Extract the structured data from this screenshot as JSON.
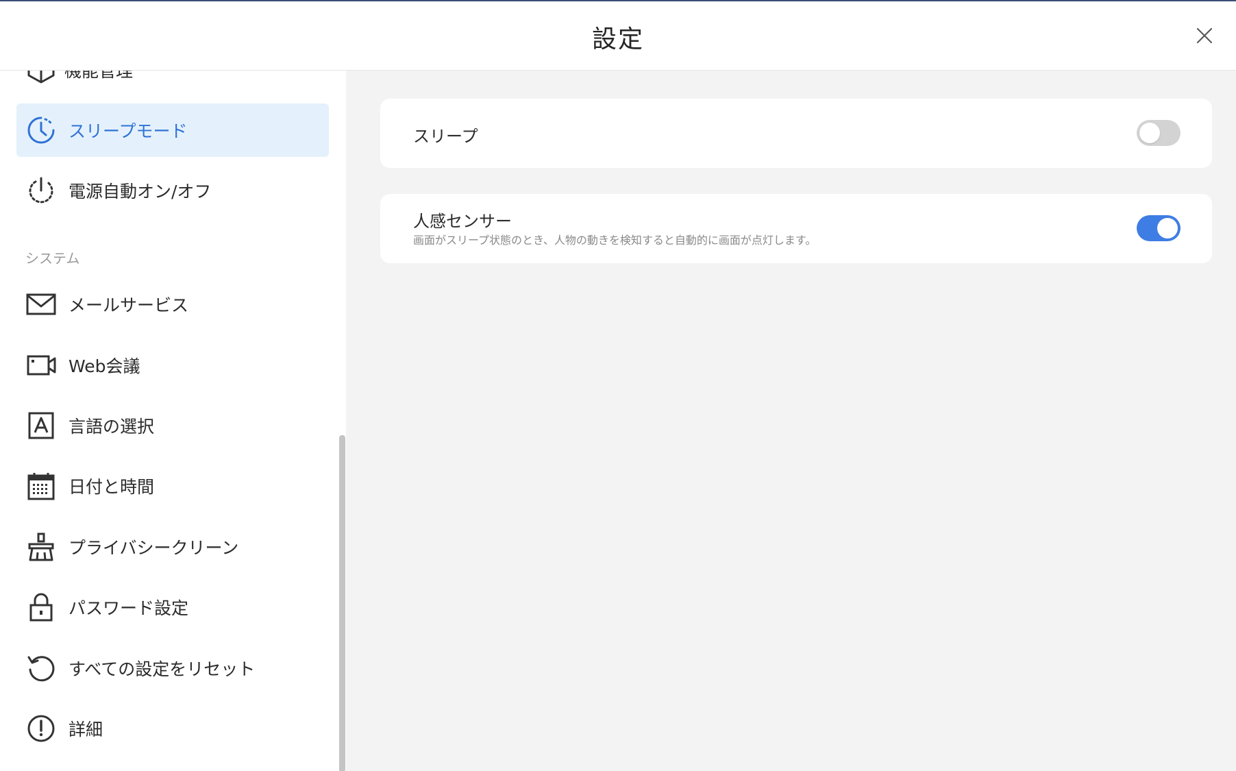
{
  "window": {
    "title": "設定"
  },
  "sidebar": {
    "partial_item": {
      "label": "機能管理"
    },
    "items_top": [
      {
        "label": "スリープモード",
        "icon": "sleep-clock-icon",
        "active": true
      },
      {
        "label": "電源自動オン/オフ",
        "icon": "power-icon",
        "active": false
      }
    ],
    "section": "システム",
    "items_system": [
      {
        "label": "メールサービス",
        "icon": "mail-icon"
      },
      {
        "label": "Web会議",
        "icon": "video-camera-icon"
      },
      {
        "label": "言語の選択",
        "icon": "language-icon"
      },
      {
        "label": "日付と時間",
        "icon": "calendar-icon"
      },
      {
        "label": "プライバシークリーン",
        "icon": "broom-icon"
      },
      {
        "label": "パスワード設定",
        "icon": "lock-icon"
      },
      {
        "label": "すべての設定をリセット",
        "icon": "reset-icon"
      },
      {
        "label": "詳細",
        "icon": "info-icon"
      }
    ]
  },
  "main": {
    "settings": [
      {
        "title": "スリープ",
        "description": "",
        "enabled": false
      },
      {
        "title": "人感センサー",
        "description": "画面がスリープ状態のとき、人物の動きを検知すると自動的に画面が点灯します。",
        "enabled": true
      }
    ]
  },
  "colors": {
    "accent": "#3e7de3",
    "active_bg": "#e4f1fc",
    "active_text": "#2f72d6",
    "content_bg": "#f3f3f3"
  }
}
